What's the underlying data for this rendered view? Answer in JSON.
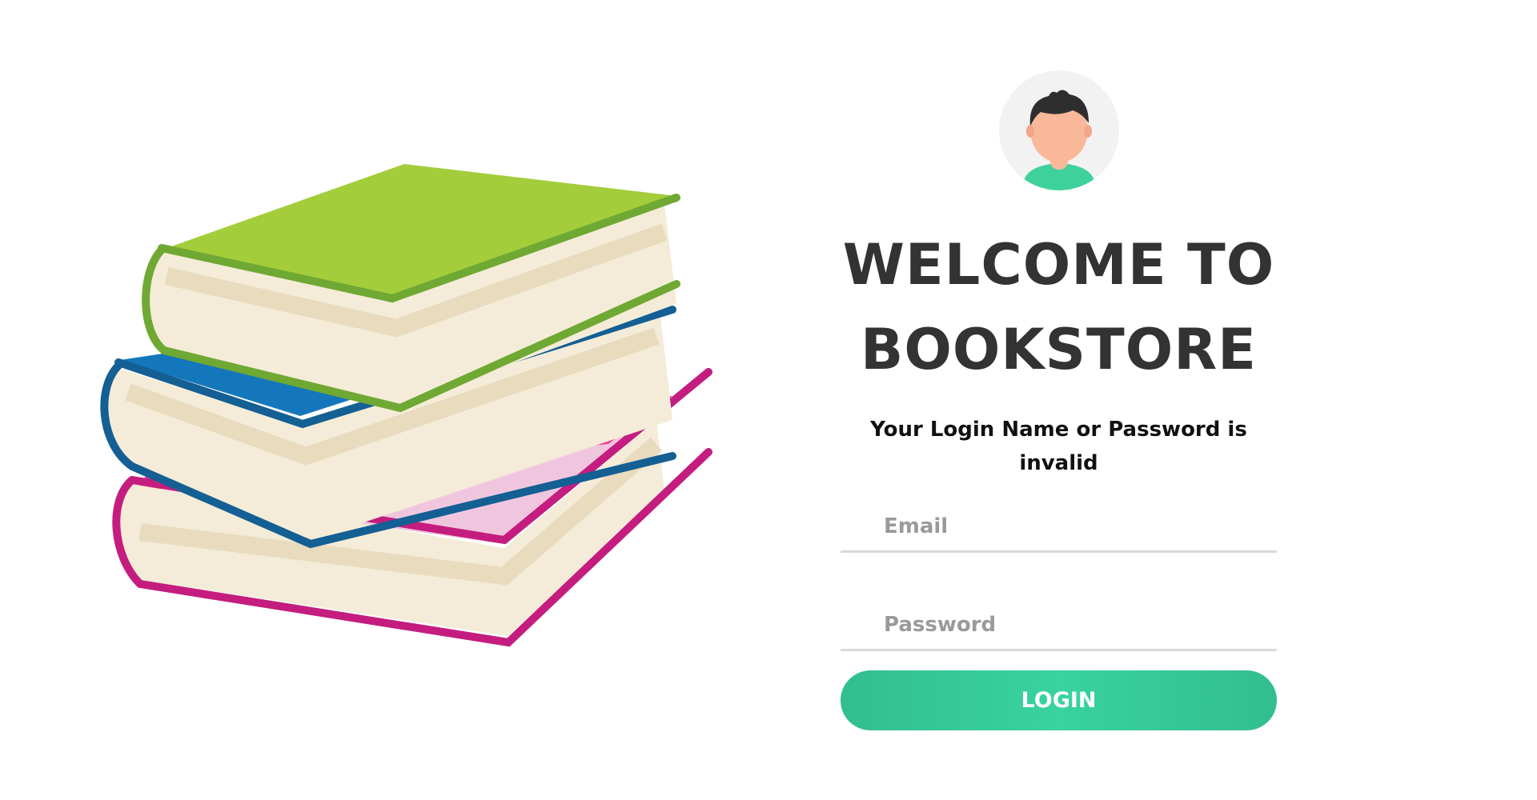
{
  "login": {
    "title_line1": "WELCOME TO",
    "title_line2": "BOOKSTORE",
    "error_message": "Your Login Name or Password is invalid",
    "email_placeholder": "Email",
    "password_placeholder": "Password",
    "login_button_label": "LOGIN"
  },
  "colors": {
    "accent": "#38d39f",
    "title_text": "#333333",
    "input_underline": "#d9d9d9"
  },
  "icons": {
    "avatar": "user-avatar-icon",
    "illustration": "stacked-books-illustration"
  }
}
